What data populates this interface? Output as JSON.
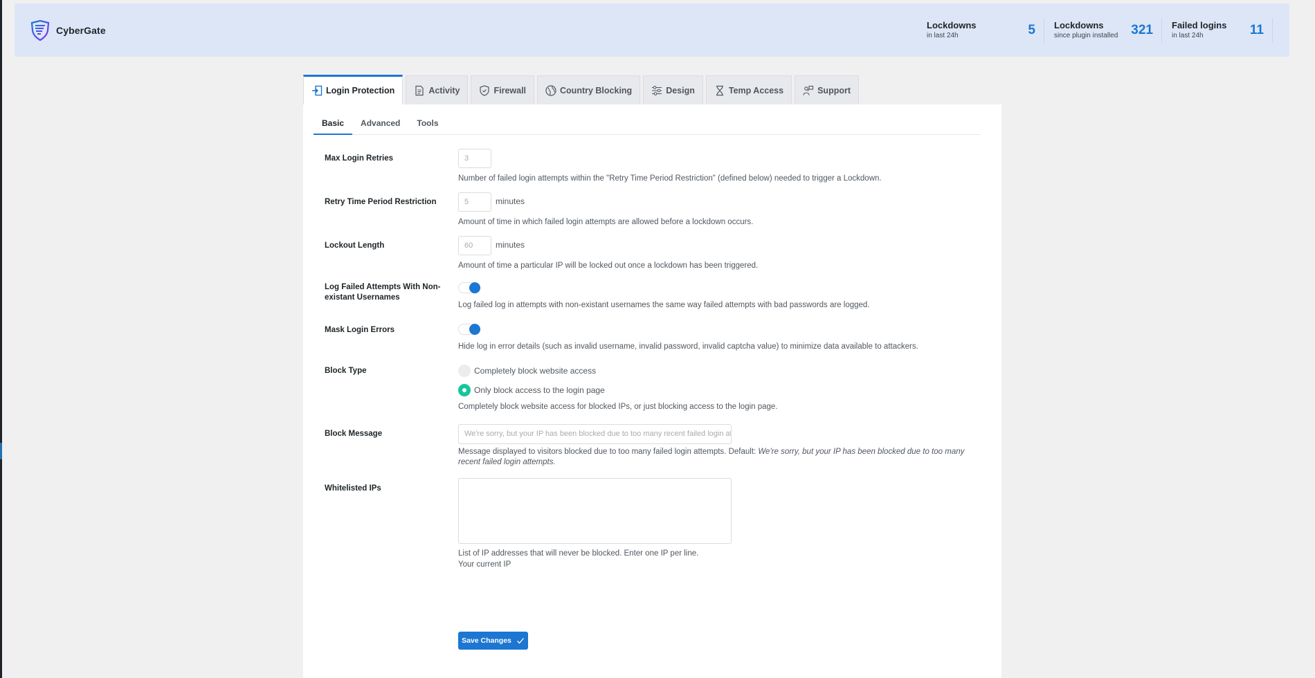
{
  "brand": {
    "name": "CyberGate"
  },
  "stats": [
    {
      "label": "Lockdowns",
      "sub": "in last 24h",
      "value": "5"
    },
    {
      "label": "Lockdowns",
      "sub": "since plugin installed",
      "value": "321"
    },
    {
      "label": "Failed logins",
      "sub": "in last 24h",
      "value": "11"
    }
  ],
  "tabs": [
    {
      "label": "Login Protection",
      "icon": "login-icon",
      "active": true
    },
    {
      "label": "Activity",
      "icon": "document-icon"
    },
    {
      "label": "Firewall",
      "icon": "shield-icon"
    },
    {
      "label": "Country Blocking",
      "icon": "globe-icon"
    },
    {
      "label": "Design",
      "icon": "sliders-icon"
    },
    {
      "label": "Temp Access",
      "icon": "hourglass-icon"
    },
    {
      "label": "Support",
      "icon": "support-icon"
    }
  ],
  "subtabs": [
    {
      "label": "Basic",
      "active": true
    },
    {
      "label": "Advanced"
    },
    {
      "label": "Tools"
    }
  ],
  "form": {
    "max_retries": {
      "label": "Max Login Retries",
      "value": "3",
      "desc": "Number of failed login attempts within the \"Retry Time Period Restriction\" (defined below) needed to trigger a Lockdown."
    },
    "retry_period": {
      "label": "Retry Time Period Restriction",
      "value": "5",
      "unit": "minutes",
      "desc": "Amount of time in which failed login attempts are allowed before a lockdown occurs."
    },
    "lockout_length": {
      "label": "Lockout Length",
      "value": "60",
      "unit": "minutes",
      "desc": "Amount of time a particular IP will be locked out once a lockdown has been triggered."
    },
    "log_failed": {
      "label": "Log Failed Attempts With Non-existant Usernames",
      "desc": "Log failed log in attempts with non-existant usernames the same way failed attempts with bad passwords are logged."
    },
    "mask_errors": {
      "label": "Mask Login Errors",
      "desc": "Hide log in error details (such as invalid username, invalid password, invalid captcha value) to minimize data available to attackers."
    },
    "block_type": {
      "label": "Block Type",
      "option1": "Completely block website access",
      "option2": "Only block access to the login page",
      "desc": "Completely block website access for blocked IPs, or just blocking access to the login page."
    },
    "block_message": {
      "label": "Block Message",
      "placeholder": "We're sorry, but your IP has been blocked due to too many recent failed login attempts.",
      "desc_prefix": "Message displayed to visitors blocked due to too many failed login attempts. Default: ",
      "desc_default": "We're sorry, but your IP has been blocked due to too many recent failed login attempts."
    },
    "whitelist": {
      "label": "Whitelisted IPs",
      "desc": "List of IP addresses that will never be blocked. Enter one IP per line.",
      "current_ip": "Your current IP"
    }
  },
  "save_button": {
    "label": "Save Changes"
  },
  "colors": {
    "accent": "#1c76d2",
    "header_bg": "#dde6f7",
    "radio_checked": "#16c79a"
  }
}
